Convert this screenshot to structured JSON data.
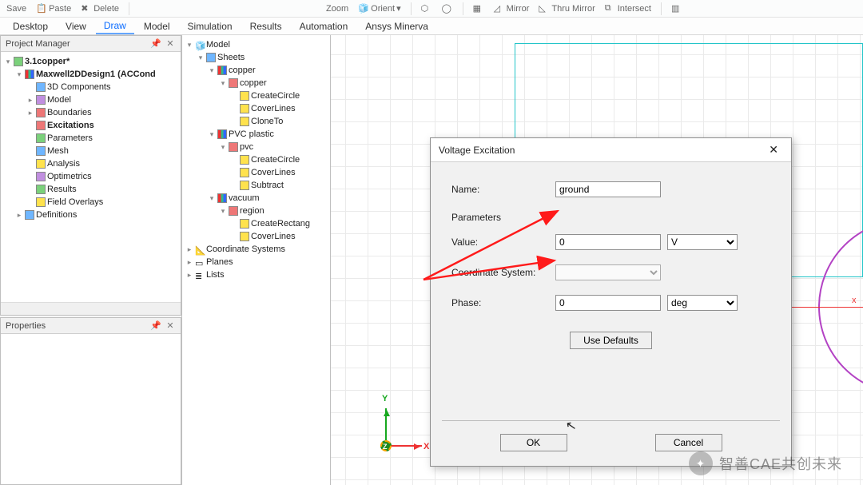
{
  "ribbon": {
    "save": "Save",
    "paste": "Paste",
    "delete": "Delete",
    "zoom": "Zoom",
    "orient": "Orient",
    "mirror": "Mirror",
    "thru_mirror": "Thru Mirror",
    "intersect": "Intersect"
  },
  "menubar": {
    "items": [
      "Desktop",
      "View",
      "Draw",
      "Model",
      "Simulation",
      "Results",
      "Automation",
      "Ansys Minerva"
    ],
    "active_index": 2
  },
  "panels": {
    "project_manager": "Project Manager",
    "properties": "Properties"
  },
  "project_tree": {
    "root": "3.1copper*",
    "design": "Maxwell2DDesign1 (ACCond",
    "items": [
      "3D Components",
      "Model",
      "Boundaries",
      "Excitations",
      "Parameters",
      "Mesh",
      "Analysis",
      "Optimetrics",
      "Results",
      "Field Overlays"
    ],
    "definitions": "Definitions"
  },
  "model_tree": {
    "model": "Model",
    "sheets": "Sheets",
    "copper_grp": "copper",
    "copper_obj": "copper",
    "copper_ops": [
      "CreateCircle",
      "CoverLines",
      "CloneTo"
    ],
    "pvc_grp": "PVC plastic",
    "pvc_obj": "pvc",
    "pvc_ops": [
      "CreateCircle",
      "CoverLines",
      "Subtract"
    ],
    "vacuum_grp": "vacuum",
    "region_obj": "region",
    "region_ops": [
      "CreateRectang",
      "CoverLines"
    ],
    "coord": "Coordinate Systems",
    "planes": "Planes",
    "lists": "Lists"
  },
  "axes": {
    "x": "x",
    "y": "Y",
    "x_triad": "X",
    "z": "Z"
  },
  "dialog": {
    "title": "Voltage Excitation",
    "name_label": "Name:",
    "name_value": "ground",
    "parameters_label": "Parameters",
    "value_label": "Value:",
    "value_value": "0",
    "value_unit_options": [
      "V"
    ],
    "coord_label": "Coordinate System:",
    "coord_value": "",
    "phase_label": "Phase:",
    "phase_value": "0",
    "phase_unit_options": [
      "deg"
    ],
    "use_defaults": "Use Defaults",
    "ok": "OK",
    "cancel": "Cancel"
  },
  "watermark": "智善CAE共创未来"
}
